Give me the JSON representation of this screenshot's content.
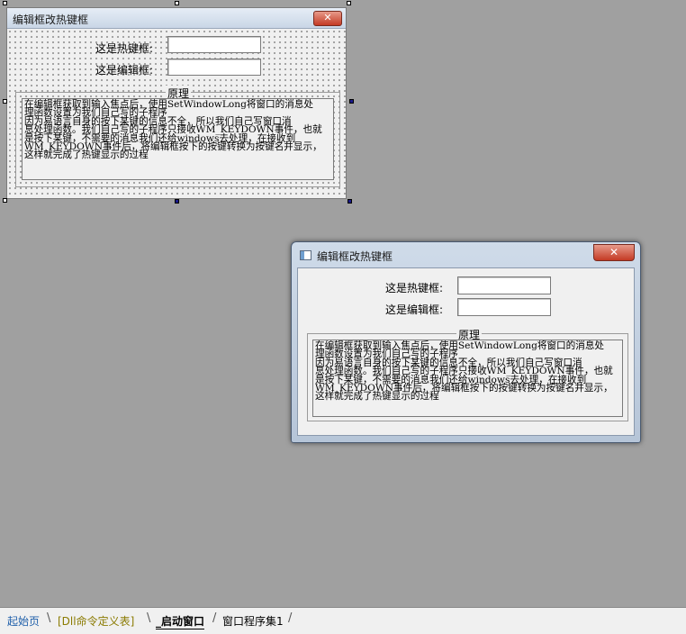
{
  "designer": {
    "title": "编辑框改热键框",
    "close_glyph": "✕",
    "hotkey_label": "这是热键框:",
    "edit_label": "这是编辑框:",
    "group_label": "原理",
    "description_lines": [
      "在编辑框获取到输入焦点后，使用SetWindowLong将窗口的消息处",
      "理函数设置为我们自己写的子程序",
      "因为易语言自身的按下某键的信息不全，所以我们自己写窗口消",
      "息处理函数。我们自己写的子程序只接收WM_KEYDOWN事件，也就",
      "是按下某键，不需要的消息我们还给windows去处理，在接收到",
      "WM_KEYDOWN事件后，将编辑框按下的按键转换为按键名并显示，",
      "这样就完成了热键显示的过程"
    ]
  },
  "runtime_window": {
    "title": "编辑框改热键框",
    "close_glyph": "✕",
    "hotkey_label": "这是热键框:",
    "edit_label": "这是编辑框:",
    "hotkey_value": "",
    "edit_value": "",
    "group_label": "原理",
    "description_lines": [
      "在编辑框获取到输入焦点后，使用SetWindowLong将窗口的消息处",
      "理函数设置为我们自己写的子程序",
      "因为易语言自身的按下某键的信息不全，所以我们自己写窗口消",
      "息处理函数。我们自己写的子程序只接收WM_KEYDOWN事件，也就",
      "是按下某键，不需要的消息我们还给windows去处理，在接收到",
      "WM_KEYDOWN事件后，将编辑框按下的按键转换为按键名并显示，",
      "这样就完成了热键显示的过程"
    ]
  },
  "tabs": [
    {
      "label": "起始页",
      "color": "#1f5faa"
    },
    {
      "label": "[Dll命令定义表]",
      "color": "#8a7a00"
    },
    {
      "label": "_启动窗口",
      "color": "#000000"
    },
    {
      "label": "窗口程序集1",
      "color": "#000000"
    }
  ],
  "colors": {
    "workspace": "#a0a0a0",
    "close_button": "#c43a24",
    "selection_handle": "#1a1a8a"
  }
}
